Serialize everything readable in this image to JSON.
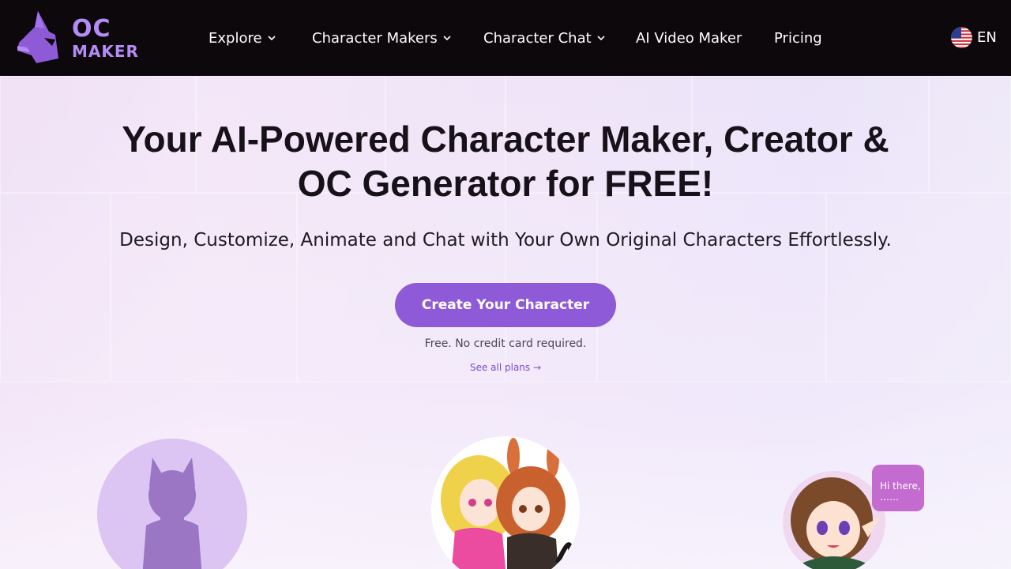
{
  "brand": {
    "line1": "OC",
    "line2": "MAKER"
  },
  "nav": {
    "explore": "Explore",
    "character_makers": "Character Makers",
    "character_chat": "Character Chat",
    "ai_video_maker": "AI Video Maker",
    "pricing": "Pricing"
  },
  "language": {
    "code": "EN",
    "flag_icon": "us-flag-icon"
  },
  "hero": {
    "headline_line1": "Your AI-Powered Character Maker, Creator &",
    "headline_line2": "OC Generator for FREE!",
    "subheadline": "Design, Customize, Animate and Chat with Your Own Original Characters Effortlessly.",
    "cta_label": "Create Your Character",
    "note": "Free. No credit card required.",
    "plans_link": "See all plans →"
  },
  "features": {
    "chat_bubble_line1": "Hi there,",
    "chat_bubble_line2": "……"
  },
  "colors": {
    "nav_bg": "#0d080c",
    "brand_purple": "#b58cf5",
    "cta_purple": "#8f5ad8",
    "link_purple": "#7c4dc9",
    "bubble_pink": "#c46bd0"
  }
}
